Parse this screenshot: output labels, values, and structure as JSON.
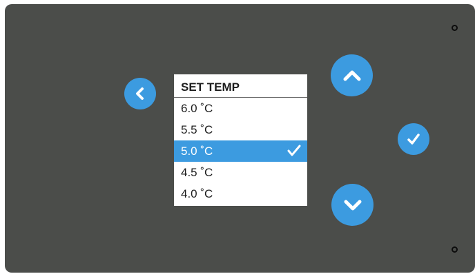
{
  "menu": {
    "title": "SET TEMP",
    "selected_index": 2,
    "options": [
      {
        "label": "6.0 ˚C"
      },
      {
        "label": "5.5 ˚C"
      },
      {
        "label": "5.0 ˚C"
      },
      {
        "label": "4.5 ˚C"
      },
      {
        "label": "4.0 ˚C"
      }
    ]
  },
  "icons": {
    "back": "chevron-left-icon",
    "up": "chevron-up-icon",
    "down": "chevron-down-icon",
    "confirm": "checkmark-icon",
    "selected_marker": "checkmark-icon"
  },
  "colors": {
    "panel": "#4b4d4a",
    "accent": "#3c9be0",
    "menu_background": "#ffffff",
    "text": "#1d1d1d"
  }
}
